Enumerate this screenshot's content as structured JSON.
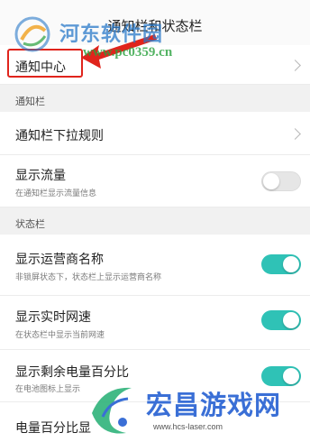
{
  "header": {
    "title": "通知栏和状态栏"
  },
  "rows": {
    "notification_center": {
      "label": "通知中心"
    },
    "pulldown_rule": {
      "label": "通知栏下拉规则"
    },
    "show_traffic": {
      "label": "显示流量",
      "sub": "在通知栏显示流量信息",
      "on": false
    },
    "show_carrier": {
      "label": "显示运营商名称",
      "sub": "非锁屏状态下，状态栏上显示运营商名称",
      "on": true
    },
    "show_speed": {
      "label": "显示实时网速",
      "sub": "在状态栏中显示当前网速",
      "on": true
    },
    "show_battery_pct": {
      "label": "显示剩余电量百分比",
      "sub": "在电池图标上显示",
      "on": true
    },
    "battery_pct_display": {
      "label": "电量百分比显"
    }
  },
  "sections": {
    "notification_bar": "通知栏",
    "status_bar": "状态栏"
  },
  "watermarks": {
    "top_name": "河东软件园",
    "top_url": "www.pc0359.cn",
    "bottom_name": "宏昌游戏网",
    "bottom_url": "www.hcs-laser.com"
  },
  "colors": {
    "toggle_on": "#2fc2b6",
    "annotation_red": "#e0241c"
  },
  "icons": {
    "chevron": "chevron-right-icon"
  }
}
